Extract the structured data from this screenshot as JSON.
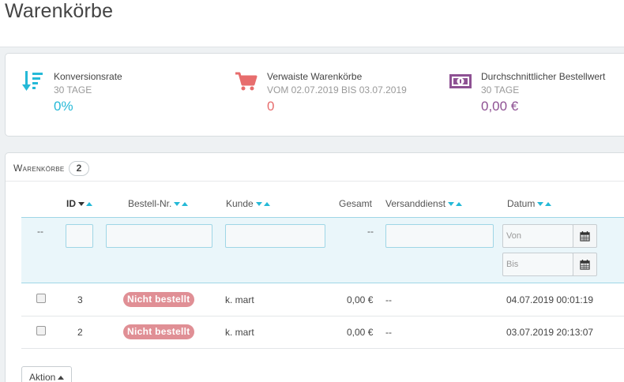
{
  "page": {
    "title": "Warenkörbe"
  },
  "kpis": [
    {
      "label": "Konversionsrate",
      "sub": "30 TAGE",
      "value": "0%",
      "icon": "sort-amount-icon",
      "color": "#25b9d7"
    },
    {
      "label": "Verwaiste Warenkörbe",
      "sub": "VOM 02.07.2019 BIS 03.07.2019",
      "value": "0",
      "icon": "shopping-cart-icon",
      "color": "#e76d6d"
    },
    {
      "label": "Durchschnittlicher Bestellwert",
      "sub": "30 TAGE",
      "value": "0,00 €",
      "icon": "money-icon",
      "color": "#8e5193"
    }
  ],
  "list": {
    "title": "Warenkörbe",
    "count": "2",
    "columns": {
      "id": "ID",
      "order": "Bestell-Nr.",
      "customer": "Kunde",
      "total": "Gesamt",
      "carrier": "Versanddienst",
      "date": "Datum"
    },
    "filters": {
      "select_placeholder": "--",
      "total_placeholder": "--",
      "date_from_placeholder": "Von",
      "date_to_placeholder": "Bis"
    },
    "rows": [
      {
        "id": "3",
        "status": "Nicht bestellt",
        "customer": "k. mart",
        "total": "0,00 €",
        "carrier": "--",
        "date": "04.07.2019 00:01:19"
      },
      {
        "id": "2",
        "status": "Nicht bestellt",
        "customer": "k. mart",
        "total": "0,00 €",
        "carrier": "--",
        "date": "03.07.2019 20:13:07"
      }
    ],
    "bulk_action_label": "Aktion"
  },
  "colors": {
    "accent": "#25b9d7",
    "danger": "#e76d6d",
    "purple": "#8e5193",
    "status_badge": "#e08f95"
  }
}
